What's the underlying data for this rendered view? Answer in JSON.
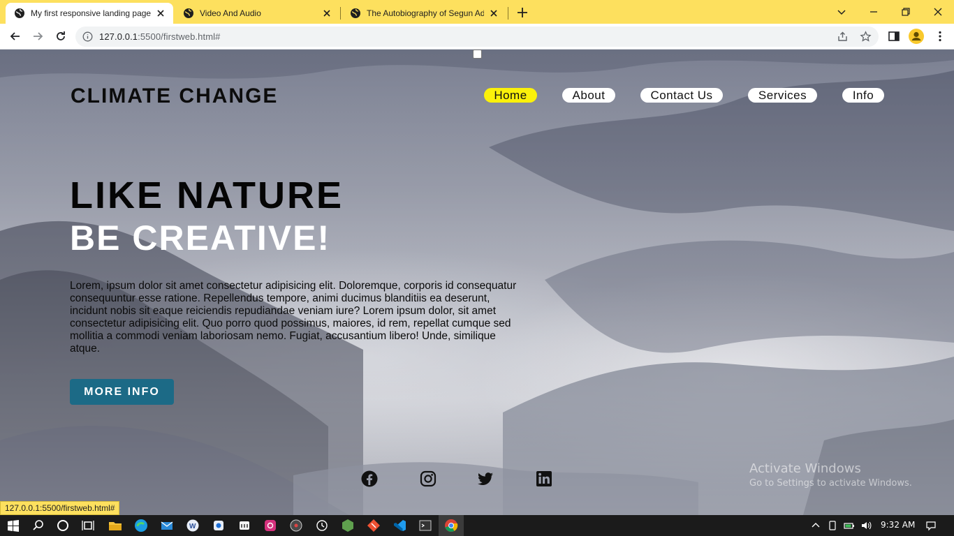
{
  "browser": {
    "tabs": [
      {
        "title": "My first responsive landing page",
        "active": true
      },
      {
        "title": "Video And Audio",
        "active": false
      },
      {
        "title": "The Autobiography of Segun Ade",
        "active": false
      }
    ],
    "url_host": "127.0.0.1",
    "url_rest": ":5500/firstweb.html#",
    "status_url": "127.0.0.1:5500/firstweb.html#",
    "accent_color": "#fde05e"
  },
  "page": {
    "brand": "CLIMATE CHANGE",
    "nav": [
      {
        "label": "Home",
        "active": true
      },
      {
        "label": "About",
        "active": false
      },
      {
        "label": "Contact Us",
        "active": false
      },
      {
        "label": "Services",
        "active": false
      },
      {
        "label": "Info",
        "active": false
      }
    ],
    "hero_line1": "LIKE NATURE",
    "hero_line2": "BE CREATIVE!",
    "lead": "Lorem, ipsum dolor sit amet consectetur adipisicing elit. Doloremque, corporis id consequatur consequuntur esse ratione. Repellendus tempore, animi ducimus blanditiis ea deserunt, incidunt nobis sit eaque reiciendis repudiandae veniam iure? Lorem ipsum dolor, sit amet consectetur adipisicing elit. Quo porro quod possimus, maiores, id rem, repellat cumque sed mollitia a commodi veniam laboriosam nemo. Fugiat, accusantium libero! Unde, similique atque.",
    "cta": "MORE INFO",
    "social": [
      "facebook-icon",
      "instagram-icon",
      "twitter-icon",
      "linkedin-icon"
    ],
    "nav_active_color": "#fbf10a",
    "cta_color": "#1c6a86"
  },
  "os": {
    "watermark_title": "Activate Windows",
    "watermark_sub": "Go to Settings to activate Windows.",
    "clock": "9:32 AM"
  }
}
